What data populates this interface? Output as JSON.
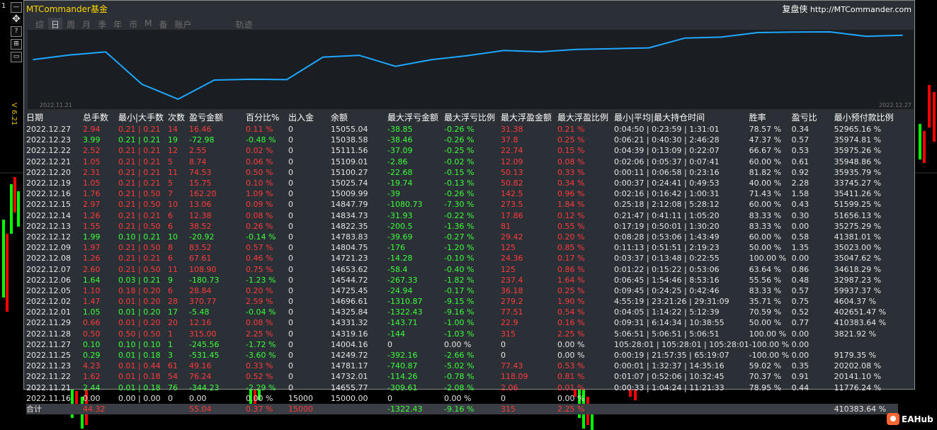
{
  "gutter": {
    "number": "1",
    "version": "V 6.21"
  },
  "toolbar": {
    "icons": [
      "minimize-icon",
      "move-icon",
      "help-icon",
      "settings-icon",
      "restore-icon"
    ],
    "minimize": "—",
    "move": "✥",
    "help": "?",
    "settings": "⊞",
    "restore": "▭"
  },
  "header": {
    "title": "MTCommander基金",
    "brand": "复盘侠",
    "url": "http://MTCommander.com"
  },
  "tabs": [
    {
      "label": "综",
      "active": false
    },
    {
      "label": "日",
      "active": true
    },
    {
      "label": "周",
      "active": false
    },
    {
      "label": "月",
      "active": false
    },
    {
      "label": "季",
      "active": false
    },
    {
      "label": "年",
      "active": false
    },
    {
      "label": "币",
      "active": false
    },
    {
      "label": "M",
      "active": false
    },
    {
      "label": "备",
      "active": false
    },
    {
      "label": "账户",
      "active": false
    },
    {
      "label": "轨迹",
      "active": false
    }
  ],
  "chart_data": {
    "type": "line",
    "x": [
      "2022.11.21",
      "2022.11.22",
      "2022.11.23",
      "2022.11.25",
      "2022.11.27",
      "2022.11.28",
      "2022.11.29",
      "2022.12.01",
      "2022.12.02",
      "2022.12.05",
      "2022.12.06",
      "2022.12.07",
      "2022.12.08",
      "2022.12.09",
      "2022.12.12",
      "2022.12.13",
      "2022.12.14",
      "2022.12.15",
      "2022.12.16",
      "2022.12.19",
      "2022.12.20",
      "2022.12.21",
      "2022.12.22",
      "2022.12.23",
      "2022.12.27"
    ],
    "values": [
      14655.77,
      14732.01,
      14781.17,
      14249.72,
      14004.16,
      14319.16,
      14331.32,
      14325.84,
      14696.61,
      14725.45,
      14544.72,
      14653.62,
      14721.23,
      14804.75,
      14783.83,
      14822.35,
      14834.73,
      14847.79,
      15009.99,
      15025.74,
      15100.27,
      15109.01,
      15111.56,
      15038.58,
      15055.04
    ],
    "start_label": "2022.11.21",
    "end_label": "2022.12.27",
    "line_color": "#1ea8ff"
  },
  "table": {
    "headers": [
      "日期",
      "总手数",
      "最小|大手数",
      "次数",
      "盈亏金额",
      "百分比%",
      "出入金",
      "余额",
      "最大浮亏金额",
      "最大浮亏比例",
      "最大浮盈金额",
      "最大浮盈比例",
      "最小|平均|最大持仓时间",
      "胜率",
      "盈亏比",
      "最小预付款比例"
    ],
    "rows": [
      {
        "c": "r",
        "v": [
          "2022.12.27",
          "2.94",
          "0.21 | 0.21",
          "14",
          "16.46",
          "0.11 %",
          "0",
          "15055.04",
          "-38.85",
          "-0.26 %",
          "31.38",
          "0.21 %",
          "0:04:50 | 0:23:59 | 1:31:01",
          "78.57 %",
          "0.34",
          "52965.16 %"
        ]
      },
      {
        "c": "g",
        "v": [
          "2022.12.23",
          "3.99",
          "0.21 | 0.21",
          "19",
          "-72.98",
          "-0.48 %",
          "0",
          "15038.58",
          "-38.46",
          "-0.26 %",
          "37.8",
          "0.25 %",
          "0:06:21 | 0:40:30 | 2:46:28",
          "47.37 %",
          "0.57",
          "35974.81 %"
        ]
      },
      {
        "c": "r",
        "v": [
          "2022.12.22",
          "2.52",
          "0.21 | 0.21",
          "12",
          "2.55",
          "0.02 %",
          "0",
          "15111.56",
          "-37.09",
          "-0.25 %",
          "22.74",
          "0.15 %",
          "0:04:39 | 0:13:09 | 0:22:07",
          "66.67 %",
          "0.53",
          "35975.26 %"
        ]
      },
      {
        "c": "r",
        "v": [
          "2022.12.21",
          "1.05",
          "0.21 | 0.21",
          "5",
          "8.74",
          "0.06 %",
          "0",
          "15109.01",
          "-2.86",
          "-0.02 %",
          "12.09",
          "0.08 %",
          "0:02:06 | 0:05:37 | 0:07:41",
          "60.00 %",
          "0.61",
          "35948.86 %"
        ]
      },
      {
        "c": "r",
        "v": [
          "2022.12.20",
          "2.31",
          "0.21 | 0.21",
          "11",
          "74.53",
          "0.50 %",
          "0",
          "15100.27",
          "-22.68",
          "-0.15 %",
          "50.13",
          "0.33 %",
          "0:00:11 | 0:06:58 | 0:23:16",
          "81.82 %",
          "0.92",
          "35935.79 %"
        ]
      },
      {
        "c": "r",
        "v": [
          "2022.12.19",
          "1.05",
          "0.21 | 0.21",
          "5",
          "15.75",
          "0.10 %",
          "0",
          "15025.74",
          "-19.74",
          "-0.13 %",
          "50.82",
          "0.34 %",
          "0:00:37 | 0:24:41 | 0:49:53",
          "40.00 %",
          "2.28",
          "33745.27 %"
        ]
      },
      {
        "c": "r",
        "v": [
          "2022.12.16",
          "1.76",
          "0.21 | 0.50",
          "7",
          "162.20",
          "1.09 %",
          "0",
          "15009.99",
          "-39",
          "-0.26 %",
          "142.5",
          "0.96 %",
          "0:02:16 | 0:16:42 | 1:00:31",
          "71.43 %",
          "1.58",
          "35411.26 %"
        ]
      },
      {
        "c": "r",
        "v": [
          "2022.12.15",
          "2.97",
          "0.21 | 0.50",
          "10",
          "13.06",
          "0.09 %",
          "0",
          "14847.79",
          "-1080.73",
          "-7.30 %",
          "273.5",
          "1.84 %",
          "0:25:18 | 2:12:08 | 5:28:12",
          "60.00 %",
          "0.43",
          "51599.25 %"
        ]
      },
      {
        "c": "r",
        "v": [
          "2022.12.14",
          "1.26",
          "0.21 | 0.21",
          "6",
          "12.38",
          "0.08 %",
          "0",
          "14834.73",
          "-31.93",
          "-0.22 %",
          "17.86",
          "0.12 %",
          "0:21:47 | 0:41:11 | 1:05:20",
          "83.33 %",
          "0.30",
          "51656.13 %"
        ]
      },
      {
        "c": "r",
        "v": [
          "2022.12.13",
          "1.55",
          "0.21 | 0.50",
          "6",
          "38.52",
          "0.26 %",
          "0",
          "14822.35",
          "-200.5",
          "-1.36 %",
          "81",
          "0.55 %",
          "0:17:19 | 0:50:01 | 1:30:20",
          "83.33 %",
          "0.00",
          "35275.29 %"
        ]
      },
      {
        "c": "g",
        "v": [
          "2022.12.12",
          "1.99",
          "0.10 | 0.21",
          "10",
          "-20.92",
          "-0.14 %",
          "0",
          "14783.83",
          "-39.69",
          "-0.27 %",
          "29.42",
          "0.20 %",
          "0:08:28 | 0:53:06 | 1:43:49",
          "60.00 %",
          "0.58",
          "41381.01 %"
        ]
      },
      {
        "c": "r",
        "v": [
          "2022.12.09",
          "1.97",
          "0.21 | 0.50",
          "8",
          "83.52",
          "0.57 %",
          "0",
          "14804.75",
          "-176",
          "-1.20 %",
          "125",
          "0.85 %",
          "0:11:13 | 0:51:51 | 2:19:23",
          "50.00 %",
          "1.35",
          "35023.00 %"
        ]
      },
      {
        "c": "r",
        "v": [
          "2022.12.08",
          "1.26",
          "0.21 | 0.21",
          "6",
          "67.61",
          "0.46 %",
          "0",
          "14721.23",
          "-14.28",
          "-0.10 %",
          "24.36",
          "0.17 %",
          "0:03:37 | 0:13:48 | 0:22:55",
          "100.00 %",
          "0.00",
          "35047.62 %"
        ]
      },
      {
        "c": "r",
        "v": [
          "2022.12.07",
          "2.60",
          "0.21 | 0.50",
          "11",
          "108.90",
          "0.75 %",
          "0",
          "14653.62",
          "-58.4",
          "-0.40 %",
          "125",
          "0.86 %",
          "0:01:22 | 0:15:22 | 0:53:06",
          "63.64 %",
          "0.86",
          "34618.29 %"
        ]
      },
      {
        "c": "g",
        "v": [
          "2022.12.06",
          "1.64",
          "0.03 | 0.21",
          "9",
          "-180.73",
          "-1.23 %",
          "0",
          "14544.72",
          "-267.33",
          "-1.82 %",
          "237.4",
          "1.64 %",
          "0:06:45 | 1:54:46 | 8:53:16",
          "55.56 %",
          "0.48",
          "32987.23 %"
        ]
      },
      {
        "c": "r",
        "v": [
          "2022.12.05",
          "1.10",
          "0.18 | 0.20",
          "6",
          "28.84",
          "0.20 %",
          "0",
          "14725.45",
          "-24.94",
          "-0.17 %",
          "36.18",
          "0.25 %",
          "0:09:45 | 0:24:25 | 0:42:46",
          "83.33 %",
          "0.57",
          "59937.37 %"
        ]
      },
      {
        "c": "r",
        "v": [
          "2022.12.02",
          "1.47",
          "0.01 | 0.20",
          "28",
          "370.77",
          "2.59 %",
          "0",
          "14696.61",
          "-1310.87",
          "-9.15 %",
          "279.2",
          "1.90 %",
          "4:55:19 | 23:21:26 | 29:31:09",
          "35.71 %",
          "0.75",
          "4604.37 %"
        ]
      },
      {
        "c": "g",
        "v": [
          "2022.12.01",
          "1.05",
          "0.01 | 0.20",
          "17",
          "-5.48",
          "-0.04 %",
          "0",
          "14325.84",
          "-1322.43",
          "-9.16 %",
          "77.51",
          "0.54 %",
          "0:04:05 | 1:14:22 | 5:12:39",
          "70.59 %",
          "0.52",
          "402651.47 %"
        ]
      },
      {
        "c": "r",
        "v": [
          "2022.11.29",
          "0.66",
          "0.01 | 0.20",
          "20",
          "12.16",
          "0.08 %",
          "0",
          "14331.32",
          "-143.71",
          "-1.00 %",
          "22.9",
          "0.16 %",
          "0:09:31 | 6:14:34 | 10:38:55",
          "50.00 %",
          "0.77",
          "410383.64 %"
        ]
      },
      {
        "c": "r",
        "v": [
          "2022.11.28",
          "0.50",
          "0.50 | 0.50",
          "1",
          "315.00",
          "2.25 %",
          "0",
          "14319.16",
          "-144",
          "-1.03 %",
          "315",
          "2.25 %",
          "5:06:51 | 5:06:51 | 5:06:51",
          "100.00 %",
          "0.00",
          "3821.92 %"
        ]
      },
      {
        "c": "g",
        "v": [
          "2022.11.27",
          "0.10",
          "0.10 | 0.10",
          "1",
          "-245.56",
          "-1.72 %",
          "0",
          "14004.16",
          "0",
          "0.00 %",
          "0",
          "0.00 %",
          "105:28:01 | 105:28:01 | 105:28:01",
          "-100.00 %",
          "0.00",
          ""
        ]
      },
      {
        "c": "g",
        "v": [
          "2022.11.25",
          "0.29",
          "0.01 | 0.18",
          "3",
          "-531.45",
          "-3.60 %",
          "0",
          "14249.72",
          "-392.16",
          "-2.66 %",
          "0",
          "0.00 %",
          "0:00:19 | 21:57:35 | 65:19:07",
          "-100.00 %",
          "0.00",
          "9179.35 %"
        ]
      },
      {
        "c": "r",
        "v": [
          "2022.11.23",
          "4.23",
          "0.01 | 0.44",
          "61",
          "49.16",
          "0.33 %",
          "0",
          "14781.17",
          "-740.87",
          "-5.02 %",
          "77.43",
          "0.53 %",
          "0:00:01 | 1:32:37 | 14:35:16",
          "59.02 %",
          "0.35",
          "20202.08 %"
        ]
      },
      {
        "c": "r",
        "v": [
          "2022.11.22",
          "1.62",
          "0.01 | 0.18",
          "54",
          "76.24",
          "0.52 %",
          "0",
          "14732.01",
          "-114.26",
          "-0.78 %",
          "118.09",
          "0.81 %",
          "0:01:07 | 0:52:06 | 10:32:45",
          "70.37 %",
          "0.91",
          "20141.10 %"
        ]
      },
      {
        "c": "g",
        "v": [
          "2022.11.21",
          "2.44",
          "0.01 | 0.18",
          "76",
          "-344.23",
          "-2.29 %",
          "0",
          "14655.77",
          "-309.61",
          "-2.08 %",
          "2.06",
          "0.01 %",
          "0:00:33 | 1:04:24 | 11:21:33",
          "78.95 %",
          "0.44",
          "11776.24 %"
        ]
      },
      {
        "c": "w",
        "v": [
          "2022.11.16",
          "0.00",
          "0.00 | 0.00",
          "0",
          "0.00",
          "0.00 %",
          "15000",
          "15000.00",
          "0",
          "0.00 %",
          "0",
          "0.00 %",
          "",
          "",
          "",
          ""
        ]
      }
    ],
    "total": [
      "合计",
      "44.32",
      "",
      "",
      "55.04",
      "0.37 %",
      "15000",
      "",
      "-1322.43",
      "-9.16 %",
      "315",
      "2.25 %",
      "",
      "",
      "",
      "410383.64 %"
    ]
  },
  "logo": {
    "text": "EAHub"
  }
}
